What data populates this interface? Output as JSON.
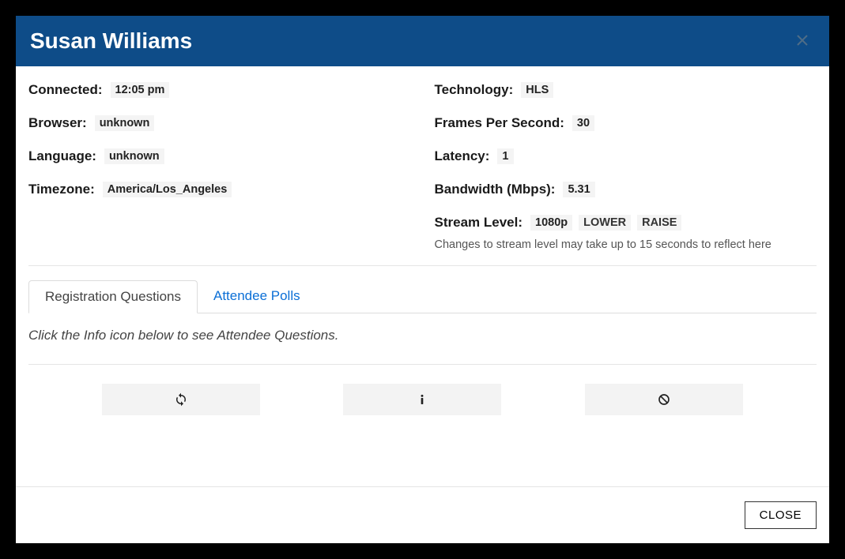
{
  "header": {
    "title": "Susan Williams"
  },
  "left": {
    "connected_label": "Connected:",
    "connected_value": "12:05 pm",
    "browser_label": "Browser:",
    "browser_value": "unknown",
    "language_label": "Language:",
    "language_value": "unknown",
    "timezone_label": "Timezone:",
    "timezone_value": "America/Los_Angeles"
  },
  "right": {
    "technology_label": "Technology:",
    "technology_value": "HLS",
    "fps_label": "Frames Per Second:",
    "fps_value": "30",
    "latency_label": "Latency:",
    "latency_value": "1",
    "bandwidth_label": "Bandwidth (Mbps):",
    "bandwidth_value": "5.31",
    "stream_level_label": "Stream Level:",
    "stream_level_value": "1080p",
    "lower_btn": "LOWER",
    "raise_btn": "RAISE",
    "stream_caption": "Changes to stream level may take up to 15 seconds to reflect here"
  },
  "tabs": {
    "registration": "Registration Questions",
    "polls": "Attendee Polls",
    "hint": "Click the Info icon below to see Attendee Questions."
  },
  "footer": {
    "close": "CLOSE"
  },
  "icons": {
    "refresh": "refresh-icon",
    "info": "info-icon",
    "ban": "ban-icon",
    "close_x": "close-icon"
  }
}
